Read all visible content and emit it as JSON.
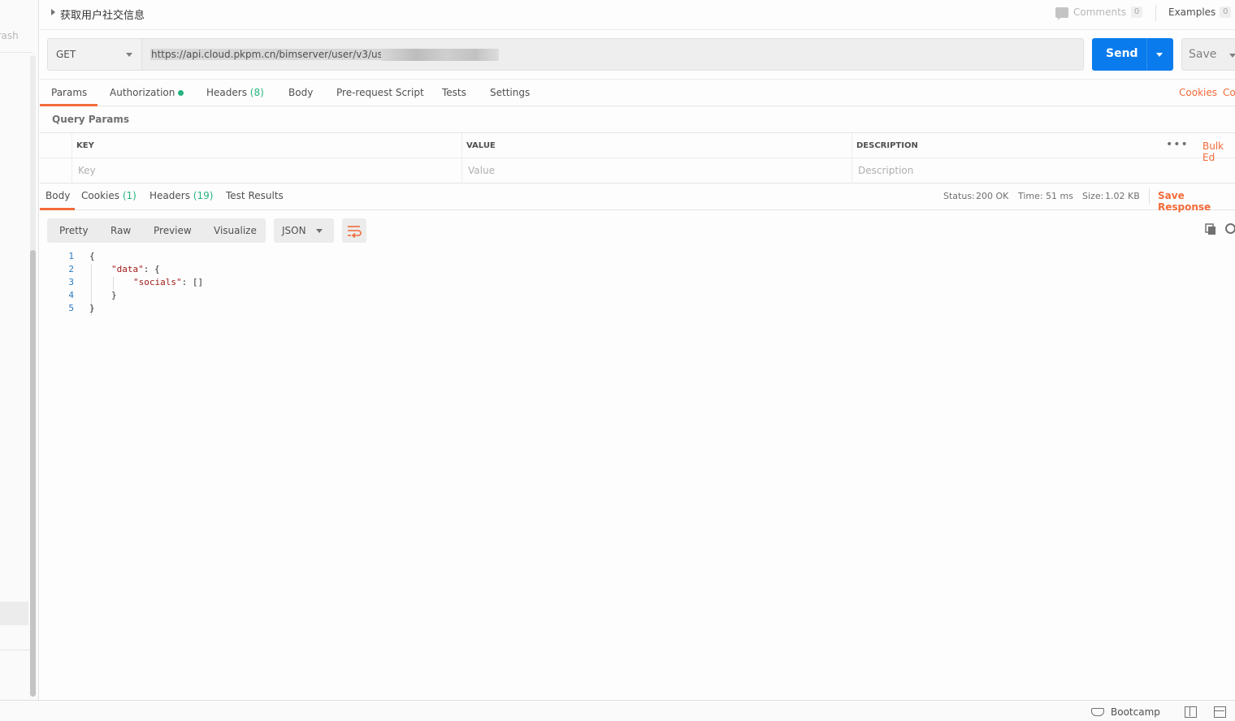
{
  "sidebar": {
    "trash_label": "Trash"
  },
  "request": {
    "title": "获取用户社交信息",
    "comments_label": "Comments",
    "comments_count": "0",
    "examples_label": "Examples",
    "examples_count": "0",
    "method": "GET",
    "url": "https://api.cloud.pkpm.cn/bimserver/user/v3/users",
    "send_label": "Send",
    "save_label": "Save"
  },
  "request_tabs": {
    "params": "Params",
    "authorization": "Authorization",
    "headers": "Headers",
    "headers_count": "(8)",
    "body": "Body",
    "prerequest": "Pre-request Script",
    "tests": "Tests",
    "settings": "Settings",
    "cookies": "Cookies",
    "code_partial": "Co"
  },
  "query_params": {
    "title": "Query Params",
    "col_key": "KEY",
    "col_value": "VALUE",
    "col_description": "DESCRIPTION",
    "key_placeholder": "Key",
    "value_placeholder": "Value",
    "description_placeholder": "Description",
    "more_label": "•••",
    "bulk_edit": "Bulk Ed"
  },
  "response_tabs": {
    "body": "Body",
    "cookies": "Cookies",
    "cookies_count": "(1)",
    "headers": "Headers",
    "headers_count": "(19)",
    "test_results": "Test Results",
    "status_label": "Status:",
    "status_value": "200 OK",
    "time_label": "Time:",
    "time_value": "51 ms",
    "size_label": "Size:",
    "size_value": "1.02 KB",
    "save_response": "Save Response"
  },
  "response_toolbar": {
    "pretty": "Pretty",
    "raw": "Raw",
    "preview": "Preview",
    "visualize": "Visualize",
    "format": "JSON"
  },
  "response_body": {
    "line_numbers": [
      "1",
      "2",
      "3",
      "4",
      "5"
    ],
    "line1": "{",
    "line2_key": "\"data\"",
    "line2_rest": ": {",
    "line3_key": "\"socials\"",
    "line3_rest": ": []",
    "line4": "}",
    "line5": "}"
  },
  "footer": {
    "bootcamp": "Bootcamp"
  },
  "colors": {
    "accent": "#f26b3a",
    "send": "#097bed",
    "success": "#26b47f"
  }
}
